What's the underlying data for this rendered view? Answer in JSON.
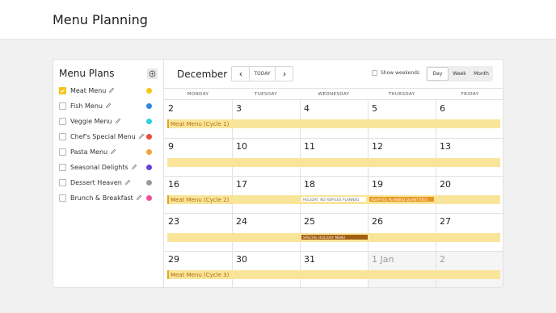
{
  "page": {
    "title": "Menu Planning"
  },
  "sidebar": {
    "title": "Menu Plans",
    "add_icon": "plus-circle-icon",
    "items": [
      {
        "label": "Meat Menu",
        "checked": true,
        "color": "#f5c518"
      },
      {
        "label": "Fish Menu",
        "checked": false,
        "color": "#2f86e6"
      },
      {
        "label": "Veggie Menu",
        "checked": false,
        "color": "#2fd3d8"
      },
      {
        "label": "Chef's Special Menu",
        "checked": false,
        "color": "#ea4b3c"
      },
      {
        "label": "Pasta Menu",
        "checked": false,
        "color": "#f2a33a"
      },
      {
        "label": "Seasonal Delights",
        "checked": false,
        "color": "#6a3fdc"
      },
      {
        "label": "Dessert Heaven",
        "checked": false,
        "color": "#9b9b9b"
      },
      {
        "label": "Brunch & Breakfast",
        "checked": false,
        "color": "#ee4f9b"
      }
    ]
  },
  "calendar": {
    "month": "December",
    "today_label": "TODAY",
    "show_weekends_label": "Show weekends",
    "views": [
      "Day",
      "Week",
      "Month"
    ],
    "active_view": "Day",
    "weekdays": [
      "MONDAY",
      "TUESDAY",
      "WEDNESDAY",
      "THURSDAY",
      "FRIDAY"
    ],
    "weeks": [
      [
        "2",
        "3",
        "4",
        "5",
        "6"
      ],
      [
        "9",
        "10",
        "11",
        "12",
        "13"
      ],
      [
        "16",
        "17",
        "18",
        "19",
        "20"
      ],
      [
        "23",
        "24",
        "25",
        "26",
        "27"
      ],
      [
        "29",
        "30",
        "31",
        "1 Jan",
        "2"
      ]
    ],
    "events": {
      "cycle1": "Meat Menu (Cycle 1)",
      "cycle2": "Meat Menu (Cycle 2)",
      "cycle3": "Meat Menu (Cycle 3)",
      "holiday_no_recipes": "HOLIDAY: NO REPICES PLANNED",
      "adapted_quantities": "ADAPTED PLANNED QUANTITIES",
      "special_holiday": "SPECIAL HOLIDAY MENU"
    }
  },
  "colors": {
    "accent": "#f5c518",
    "event_bar": "#f9e59a",
    "event_text": "#b36b0a"
  }
}
